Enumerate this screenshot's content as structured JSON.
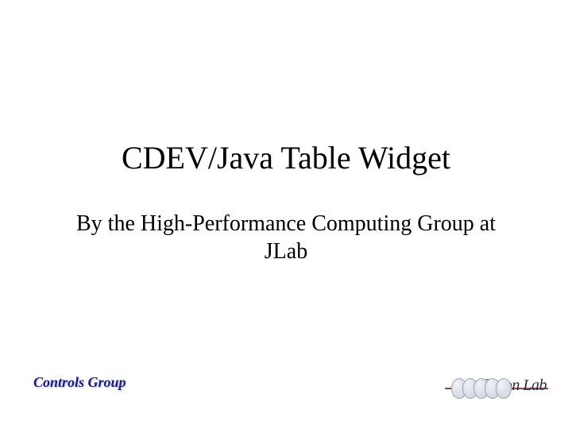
{
  "slide": {
    "title": "CDEV/Java Table Widget",
    "subtitle": "By the High-Performance Computing Group at JLab"
  },
  "footer": {
    "left_text": "Controls Group",
    "right_logo_text": "Jefferson Lab"
  }
}
